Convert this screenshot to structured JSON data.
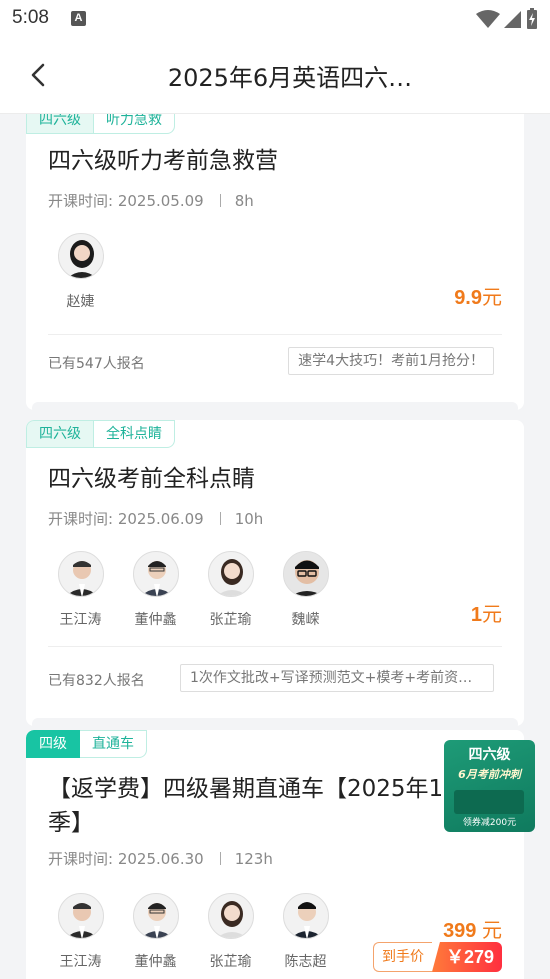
{
  "status_bar": {
    "time": "5:08",
    "notif_icon": "A"
  },
  "nav": {
    "title": "2025年6月英语四六…"
  },
  "courses": [
    {
      "tags": [
        "四六级",
        "听力急救"
      ],
      "title": "四六级听力考前急救营",
      "start_label": "开课时间: 2025.05.09",
      "duration": "8h",
      "teachers": [
        {
          "name": "赵婕"
        }
      ],
      "price_value": "9.9",
      "price_unit": "元",
      "enroll": "已有547人报名",
      "slogan": "速学4大技巧！考前1月抢分！"
    },
    {
      "tags": [
        "四六级",
        "全科点睛"
      ],
      "title": "四六级考前全科点睛",
      "start_label": "开课时间: 2025.06.09",
      "duration": "10h",
      "teachers": [
        {
          "name": "王江涛"
        },
        {
          "name": "董仲蠡"
        },
        {
          "name": "张芷瑜"
        },
        {
          "name": "魏嵘"
        }
      ],
      "price_value": "1",
      "price_unit": "元",
      "enroll": "已有832人报名",
      "slogan": "1次作文批改+写译预测范文+模考+考前资料..."
    },
    {
      "tags": [
        "四级",
        "直通车"
      ],
      "title": "【返学费】四级暑期直通车【2025年1季】",
      "start_label": "开课时间: 2025.06.30",
      "duration": "123h",
      "teachers": [
        {
          "name": "王江涛"
        },
        {
          "name": "董仲蠡"
        },
        {
          "name": "张芷瑜"
        },
        {
          "name": "陈志超"
        }
      ],
      "price_value": "399",
      "price_unit": "元",
      "final_label": "到手价",
      "final_price": "￥279"
    }
  ],
  "promo": {
    "line1": "四六级",
    "line2": "6月考前冲刺",
    "foot": "领券减200元"
  },
  "colors": {
    "accent": "#18c4a3",
    "price": "#f07a1b",
    "final_price_bg": "#ff2f3f"
  }
}
